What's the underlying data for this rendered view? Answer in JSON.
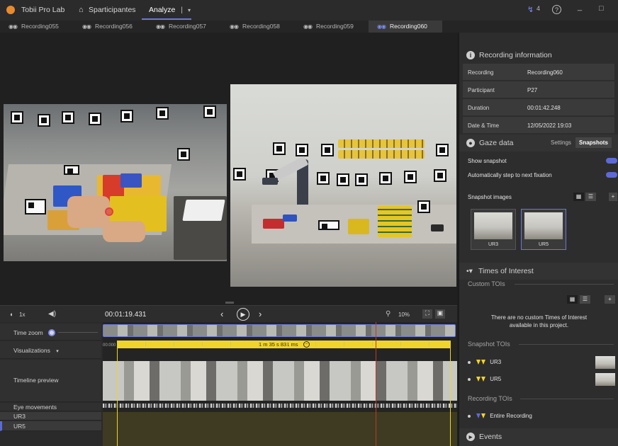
{
  "titlebar": {
    "app_title": "Tobii Pro Lab",
    "projects_label": "Sparticipantes",
    "analyze_tab": "Analyze",
    "analyze_sep": "|",
    "analyze_chevron": "▾",
    "notif_count": "4",
    "help_icon": "?",
    "minimize_icon": "_",
    "maximize_icon": "□"
  },
  "recording_tabs": [
    {
      "label": "Recording055",
      "active": false
    },
    {
      "label": "Recording056",
      "active": false
    },
    {
      "label": "Recording057",
      "active": false
    },
    {
      "label": "Recording058",
      "active": false
    },
    {
      "label": "Recording059",
      "active": false
    },
    {
      "label": "Recording060",
      "active": true
    }
  ],
  "panel": {
    "recording_info": {
      "title": "Recording information",
      "rows": [
        {
          "key": "Recording",
          "value": "Recording060"
        },
        {
          "key": "Participant",
          "value": "P27"
        },
        {
          "key": "Duration",
          "value": "00:01:42.248"
        },
        {
          "key": "Date & Time",
          "value": "12/05/2022 19:03"
        }
      ]
    },
    "gaze_data": {
      "title": "Gaze data",
      "tab_settings": "Settings",
      "tab_snapshots": "Snapshots",
      "show_snapshot": "Show snapshot",
      "auto_step": "Automatically step to next fixation",
      "snapshot_images": "Snapshot images",
      "add": "+",
      "thumbnails": [
        "UR3",
        "UR5"
      ]
    },
    "toi": {
      "title": "Times of Interest",
      "custom_tois": "Custom TOIs",
      "empty_msg_1": "There are no custom Times of Interest",
      "empty_msg_2": "available in this project.",
      "snapshot_tois": "Snapshot TOIs",
      "snapshot_items": [
        "UR3",
        "UR5"
      ],
      "recording_tois": "Recording TOIs",
      "recording_items": [
        "Entire Recording"
      ]
    },
    "events": {
      "title": "Events"
    }
  },
  "timeline": {
    "speed": "1x",
    "time": "00:01:19.431",
    "zoom_pct": "10%",
    "time_zoom": "Time zoom",
    "visualizations": "Visualizations",
    "start_time": "00:000",
    "selection_label": "1 m 35 s 831 ms",
    "timeline_preview": "Timeline preview",
    "eye_movements": "Eye movements",
    "rows": [
      "UR3",
      "UR5"
    ]
  },
  "colors": {
    "accent": "#5d6ad6",
    "selection": "#f0d42a",
    "playhead": "#c0392b"
  }
}
